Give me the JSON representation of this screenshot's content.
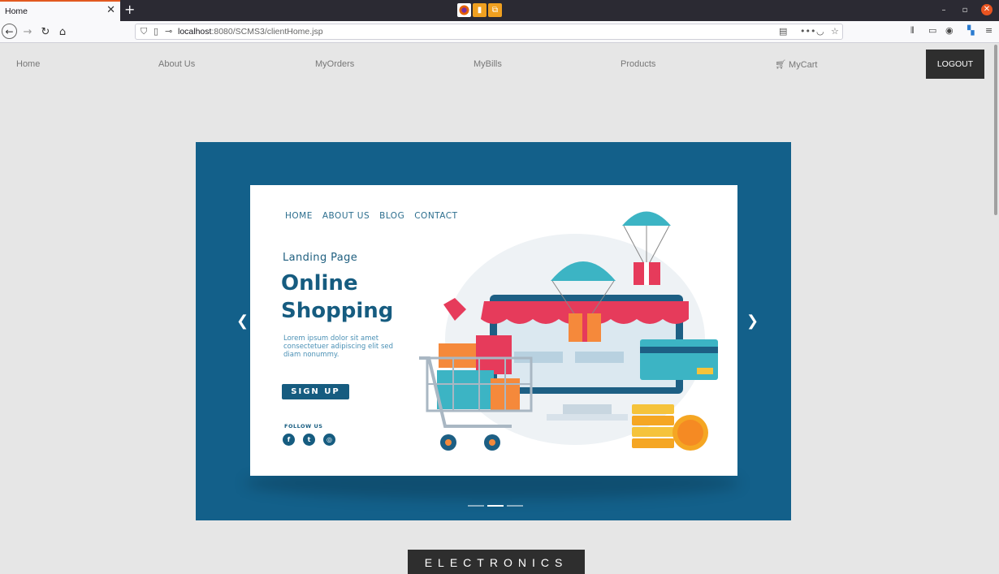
{
  "browser": {
    "tab_title": "Home",
    "url_host": "localhost",
    "url_path": ":8080/SCMS3/clientHome.jsp"
  },
  "nav": {
    "home": "Home",
    "about": "About Us",
    "orders": "MyOrders",
    "bills": "MyBills",
    "products": "Products",
    "cart": "MyCart",
    "logout": "LOGOUT"
  },
  "slide": {
    "menu": [
      "HOME",
      "ABOUT US",
      "BLOG",
      "CONTACT"
    ],
    "subtitle": "Landing Page",
    "title_line1": "Online",
    "title_line2": "Shopping",
    "lorem": "Lorem ipsum dolor sit amet consectetuer adipiscing elit sed diam nonummy.",
    "signup": "SIGN UP",
    "follow": "FOLLOW US",
    "social_icons": [
      "facebook-icon",
      "twitter-icon",
      "instagram-icon"
    ]
  },
  "carousel": {
    "slide_count": 3,
    "active_index": 1
  },
  "category_label": "ELECTRONICS",
  "colors": {
    "carousel_bg": "#13608a",
    "accent_dark": "#2e2e2e",
    "tab_accent": "#e25920"
  }
}
